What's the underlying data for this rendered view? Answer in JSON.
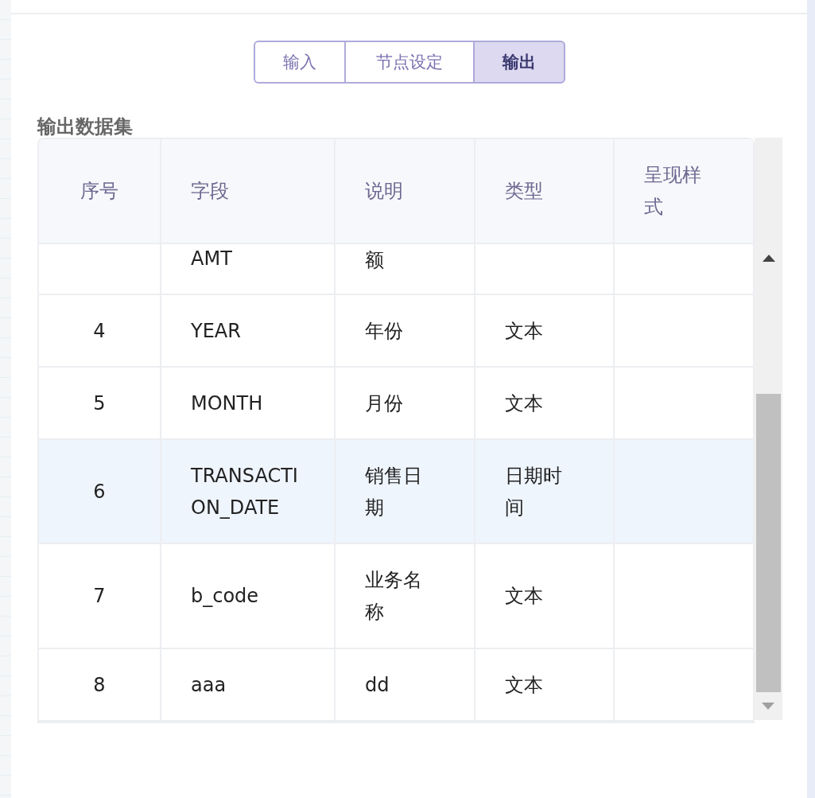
{
  "tabs": [
    {
      "label": "输入",
      "selected": false
    },
    {
      "label": "节点设定",
      "selected": false
    },
    {
      "label": "输出",
      "selected": true
    }
  ],
  "section_title": "输出数据集",
  "table": {
    "columns": [
      "序号",
      "字段",
      "说明",
      "类型",
      "呈现样式"
    ],
    "partial_row": {
      "field": "AMT",
      "description": "额"
    },
    "rows": [
      {
        "index": "4",
        "field": "YEAR",
        "description": "年份",
        "type": "文本",
        "highlighted": false
      },
      {
        "index": "5",
        "field": "MONTH",
        "description": "月份",
        "type": "文本",
        "highlighted": false
      },
      {
        "index": "6",
        "field": "TRANSACTION_DATE",
        "description": "销售日期",
        "type": "日期时间",
        "highlighted": true
      },
      {
        "index": "7",
        "field": "b_code",
        "description": "业务名称",
        "type": "文本",
        "highlighted": false
      },
      {
        "index": "8",
        "field": "aaa",
        "description": "dd",
        "type": "文本",
        "highlighted": false
      }
    ]
  }
}
